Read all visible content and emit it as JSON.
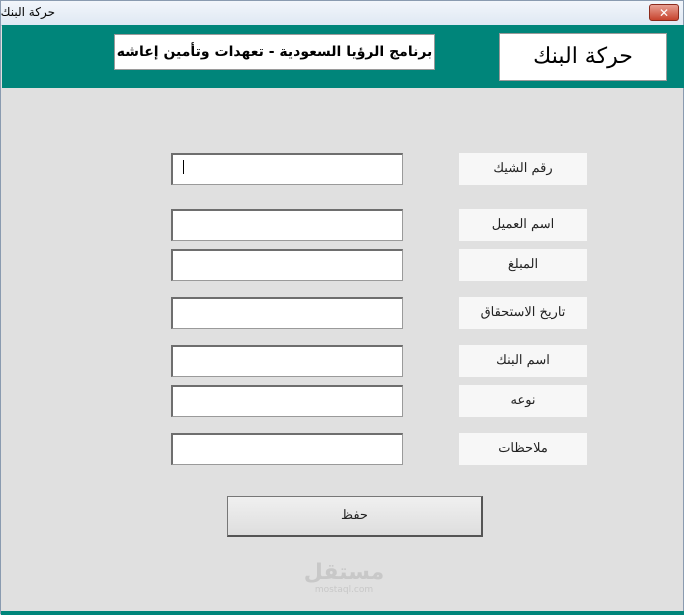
{
  "window": {
    "title": "حركة البنك",
    "close_glyph": "✕"
  },
  "header": {
    "program_name": "برنامج الرؤيا السعودية - تعهدات وتأمين إعاشه",
    "form_title": "حركة البنك"
  },
  "fields": [
    {
      "label": "رقم الشيك",
      "value": ""
    },
    {
      "label": "اسم العميل",
      "value": ""
    },
    {
      "label": "المبلغ",
      "value": ""
    },
    {
      "label": "تاريخ الاستحقاق",
      "value": ""
    },
    {
      "label": "اسم البنك",
      "value": ""
    },
    {
      "label": "نوعه",
      "value": ""
    },
    {
      "label": "ملاحظات",
      "value": ""
    }
  ],
  "actions": {
    "save_label": "حفظ"
  },
  "watermark": {
    "main": "مستقل",
    "sub": "mostaql.com"
  },
  "colors": {
    "accent": "#00857a"
  }
}
